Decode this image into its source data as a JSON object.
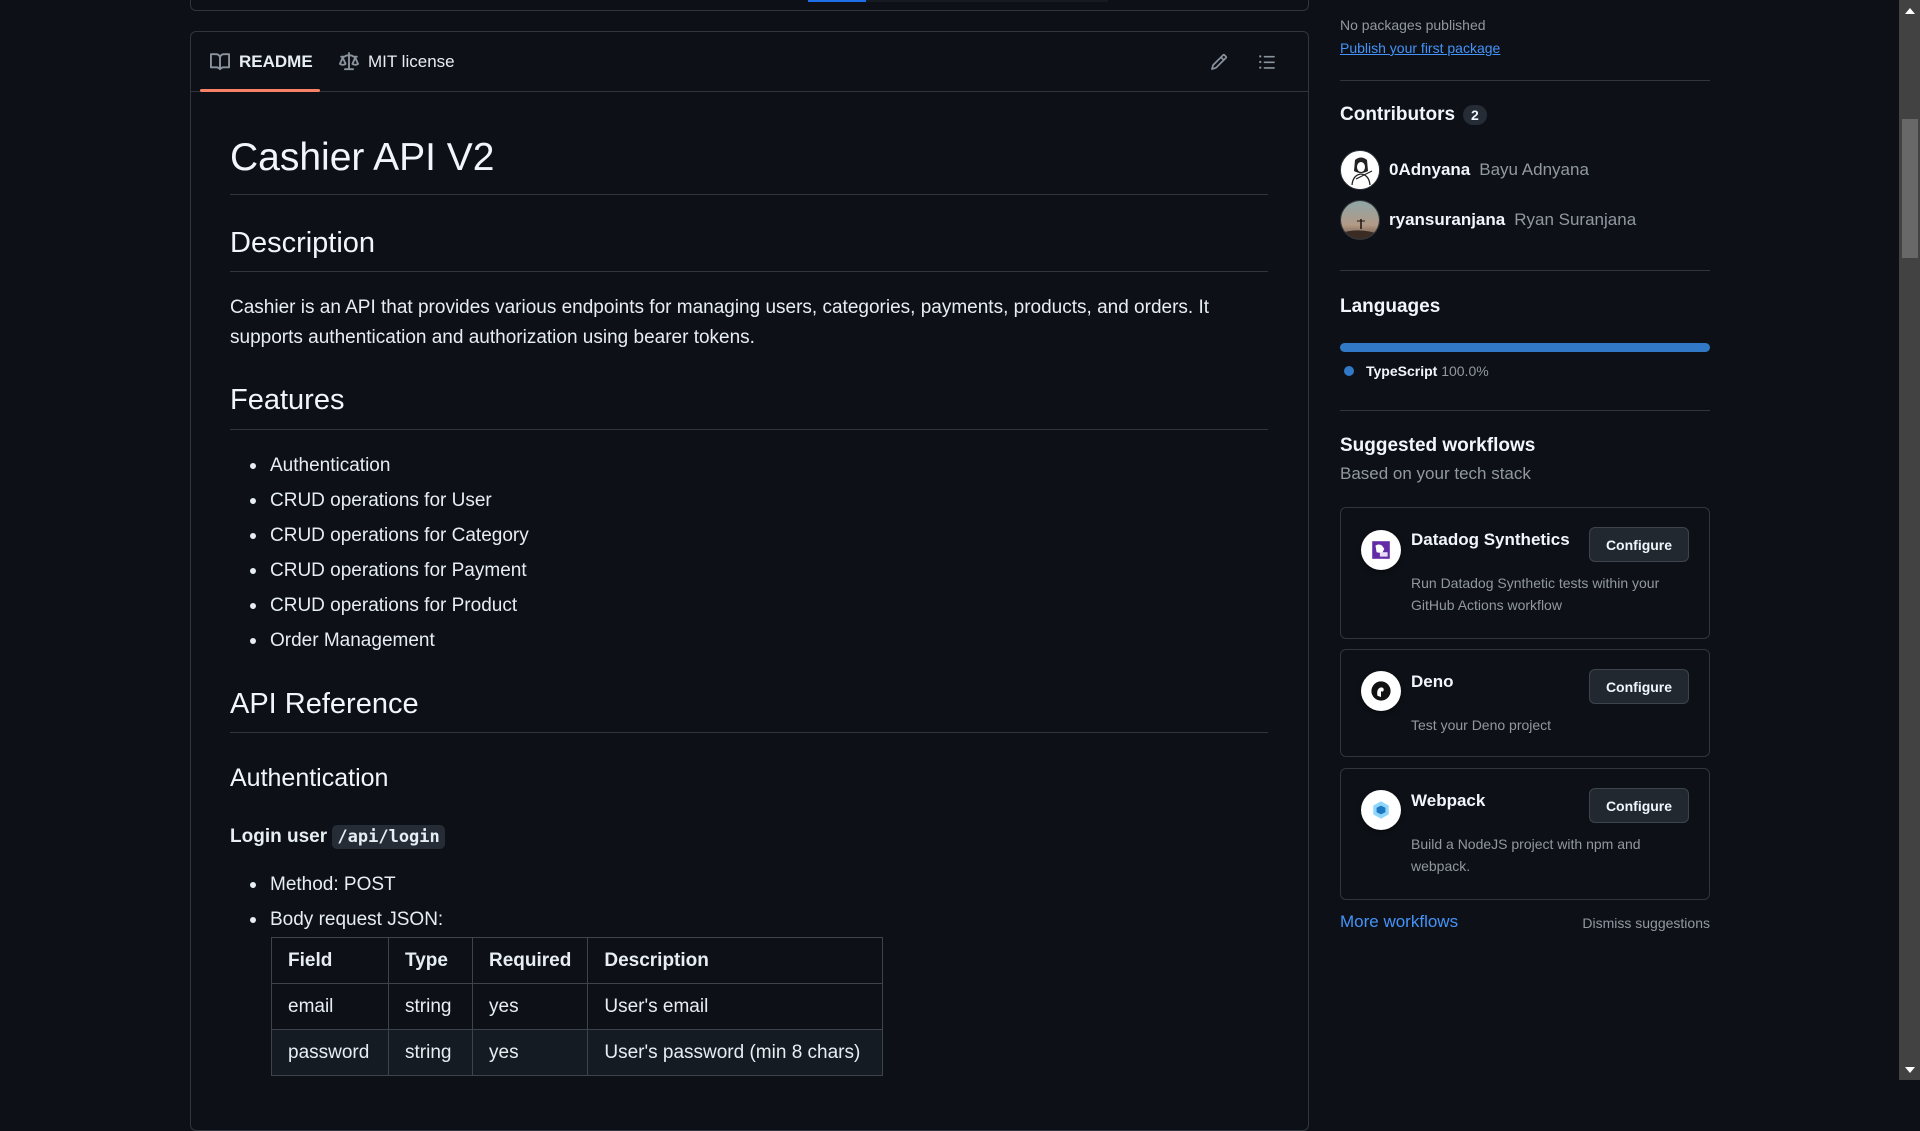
{
  "readme_tabs": [
    {
      "label": "README",
      "icon": "book-icon",
      "active": true
    },
    {
      "label": "MIT license",
      "icon": "law-icon",
      "active": false
    }
  ],
  "header_icons": [
    "pencil-icon",
    "list-unordered-icon"
  ],
  "readme": {
    "title": "Cashier API V2",
    "description_heading": "Description",
    "description_text": "Cashier is an API that provides various endpoints for managing users, categories, payments, products, and orders. It supports authentication and authorization using bearer tokens.",
    "features_heading": "Features",
    "features": [
      "Authentication",
      "CRUD operations for User",
      "CRUD operations for Category",
      "CRUD operations for Payment",
      "CRUD operations for Product",
      "Order Management"
    ],
    "api_reference_heading": "API Reference",
    "authentication_heading": "Authentication",
    "login_label": "Login user",
    "login_path": "/api/login",
    "login_details": [
      "Method: POST",
      "Body request JSON:"
    ],
    "body_table": {
      "headers": [
        "Field",
        "Type",
        "Required",
        "Description"
      ],
      "rows": [
        [
          "email",
          "string",
          "yes",
          "User's email"
        ],
        [
          "password",
          "string",
          "yes",
          "User's password (min 8 chars)"
        ]
      ]
    }
  },
  "sidebar": {
    "packages": {
      "status": "No packages published",
      "link": "Publish your first package"
    },
    "contributors": {
      "heading": "Contributors",
      "count": "2",
      "items": [
        {
          "username": "0Adnyana",
          "name": "Bayu Adnyana"
        },
        {
          "username": "ryansuranjana",
          "name": "Ryan Suranjana"
        }
      ]
    },
    "languages": {
      "heading": "Languages",
      "items": [
        {
          "name": "TypeScript",
          "percent": "100.0%",
          "share": 100,
          "color": "#3178c6"
        }
      ]
    },
    "workflows": {
      "heading": "Suggested workflows",
      "subheading": "Based on your tech stack",
      "items": [
        {
          "title": "Datadog Synthetics",
          "description": "Run Datadog Synthetic tests within your GitHub Actions workflow",
          "button": "Configure",
          "icon": "datadog-icon"
        },
        {
          "title": "Deno",
          "description": "Test your Deno project",
          "button": "Configure",
          "icon": "deno-icon"
        },
        {
          "title": "Webpack",
          "description": "Build a NodeJS project with npm and webpack.",
          "button": "Configure",
          "icon": "webpack-icon"
        }
      ],
      "more_link": "More workflows",
      "dismiss_link": "Dismiss suggestions"
    }
  },
  "colors": {
    "background": "#0d1117",
    "accent_link": "#4493f8",
    "tab_underline": "#f78166",
    "typescript": "#3178c6"
  }
}
